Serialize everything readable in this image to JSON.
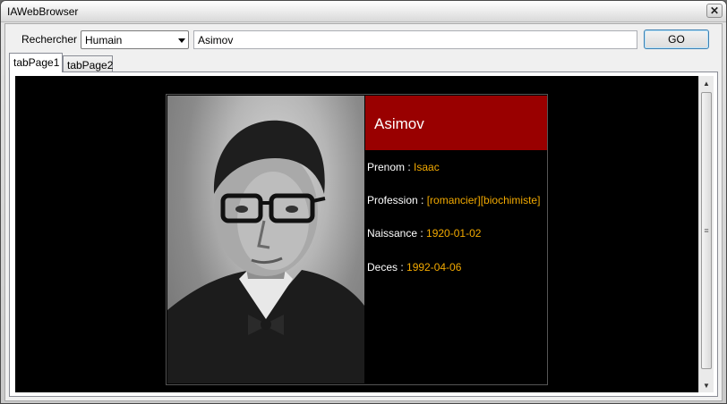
{
  "window": {
    "title": "IAWebBrowser",
    "close_glyph": "✕"
  },
  "search": {
    "label": "Rechercher",
    "category": "Humain",
    "query": "Asimov",
    "go_label": "GO"
  },
  "tabs": [
    {
      "label": "tabPage1",
      "active": true
    },
    {
      "label": "tabPage2",
      "active": false
    }
  ],
  "card": {
    "name": "Asimov",
    "fields": [
      {
        "label": "Prenom : ",
        "value": "Isaac"
      },
      {
        "label": "Profession : ",
        "value": "[romancier][biochimiste]"
      },
      {
        "label": "Naissance : ",
        "value": "1920-01-02"
      },
      {
        "label": "Deces : ",
        "value": "1992-04-06"
      }
    ],
    "photo_icon": "portrait-photo"
  },
  "colors": {
    "banner": "#990000",
    "value_text": "#f2a900",
    "background": "#000000"
  }
}
